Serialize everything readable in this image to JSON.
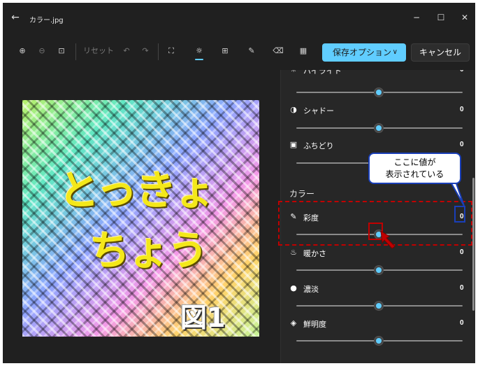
{
  "window": {
    "title": "カラー.jpg",
    "back_icon": "arrow-left-icon",
    "minimize_glyph": "−",
    "maximize_glyph": "☐",
    "close_glyph": "✕"
  },
  "toolbar": {
    "zoom_in_glyph": "⊕",
    "zoom_out_glyph": "⊖",
    "fit_glyph": "⊡",
    "reset_label": "リセット",
    "undo_glyph": "↶",
    "redo_glyph": "↷",
    "crop_glyph": "⛶",
    "adjust_glyph": "☼",
    "filter_glyph": "⊞",
    "markup_glyph": "✎",
    "erase_glyph": "⌫",
    "background_glyph": "▦",
    "save_label": "保存オプション",
    "save_chevron": "∨",
    "cancel_label": "キャンセル",
    "accent_color": "#60cdff"
  },
  "image": {
    "line1": "とっきょ",
    "line2": "ちょう",
    "figure_label": "図1"
  },
  "panel": {
    "partial_label": "ハイライト",
    "partial_value": "0",
    "shadow": {
      "label": "シャドー",
      "value": "0",
      "icon": "half-circle-icon",
      "glyph": "◑"
    },
    "vignette": {
      "label": "ふちどり",
      "value": "0",
      "icon": "vignette-square-icon",
      "glyph": "▣"
    },
    "color_section": "カラー",
    "saturation": {
      "label": "彩度",
      "value": "0",
      "icon": "dropper-icon",
      "glyph": "✎"
    },
    "warmth": {
      "label": "暖かさ",
      "value": "0",
      "icon": "thermometer-icon",
      "glyph": "🌡"
    },
    "tint": {
      "label": "濃淡",
      "value": "0",
      "icon": "drop-icon",
      "glyph": "💧"
    },
    "vibrance": {
      "label": "鮮明度",
      "value": "0",
      "icon": "gem-icon",
      "glyph": "◈"
    }
  },
  "annotation": {
    "callout_line1": "ここに値が",
    "callout_line2": "表示されている",
    "highlight_color": "#c00000",
    "callout_border_color": "#1a3fb8"
  }
}
